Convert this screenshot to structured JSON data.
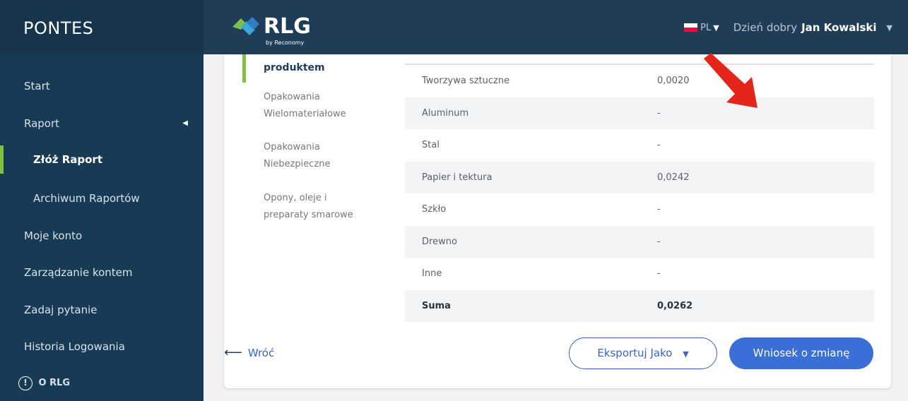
{
  "app": {
    "brand": "PONTES",
    "logo_text": "RLG",
    "logo_sub": "by Reconomy"
  },
  "header": {
    "language": "PL",
    "greeting": "Dzień dobry",
    "user_name": "Jan Kowalski"
  },
  "sidebar": {
    "items": [
      {
        "label": "Start"
      },
      {
        "label": "Raport"
      },
      {
        "label": "Złóż Raport"
      },
      {
        "label": "Archiwum Raportów"
      },
      {
        "label": "Moje konto"
      },
      {
        "label": "Zarządzanie kontem"
      },
      {
        "label": "Zadaj pytanie"
      },
      {
        "label": "Historia Logowania"
      },
      {
        "label": "O RLG"
      }
    ]
  },
  "categories": [
    {
      "label": "produktem"
    },
    {
      "label": "Opakowania Wielomateriałowe"
    },
    {
      "label": "Opakowania Niebezpieczne"
    },
    {
      "label": "Opony, oleje i preparaty smarowe"
    }
  ],
  "table": {
    "rows": [
      {
        "material": "Tworzywa sztuczne",
        "value": "0,0020"
      },
      {
        "material": "Aluminum",
        "value": "-"
      },
      {
        "material": "Stal",
        "value": "-"
      },
      {
        "material": "Papier i tektura",
        "value": "0,0242"
      },
      {
        "material": "Szkło",
        "value": "-"
      },
      {
        "material": "Drewno",
        "value": "-"
      },
      {
        "material": "Inne",
        "value": "-"
      },
      {
        "material": "Suma",
        "value": "0,0262"
      }
    ]
  },
  "actions": {
    "back": "Wróć",
    "export": "Eksportuj Jako",
    "request_change": "Wniosek o zmianę"
  },
  "colors": {
    "sidebar_bg": "#173a55",
    "topbar_bg": "#1f3d57",
    "accent_green": "#7fc241",
    "primary_blue": "#3b6fd8",
    "arrow_red": "#e32619"
  }
}
